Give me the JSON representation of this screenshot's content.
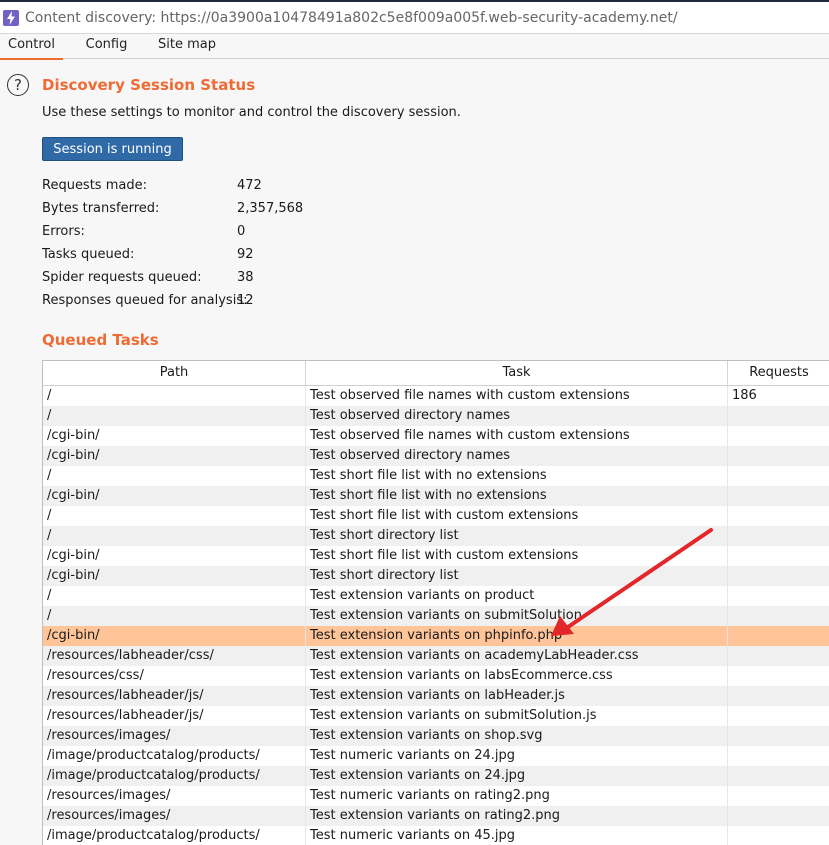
{
  "window": {
    "title": "Content discovery: https://0a3900a10478491a802c5e8f009a005f.web-security-academy.net/"
  },
  "tabs": [
    {
      "label": "Control"
    },
    {
      "label": "Config"
    },
    {
      "label": "Site map"
    }
  ],
  "status": {
    "heading": "Discovery Session Status",
    "description": "Use these settings to monitor and control the discovery session.",
    "button_label": "Session is running",
    "stats": [
      {
        "label": "Requests made:",
        "value": "472"
      },
      {
        "label": "Bytes transferred:",
        "value": "2,357,568"
      },
      {
        "label": "Errors:",
        "value": "0"
      },
      {
        "label": "Tasks queued:",
        "value": "92"
      },
      {
        "label": "Spider requests queued:",
        "value": "38"
      },
      {
        "label": "Responses queued for analysis:",
        "value": "12"
      }
    ]
  },
  "queued": {
    "heading": "Queued Tasks",
    "columns": [
      "Path",
      "Task",
      "Requests"
    ],
    "rows": [
      {
        "path": "/",
        "task": "Test observed file names with custom extensions",
        "requests": "186"
      },
      {
        "path": "/",
        "task": "Test observed directory names",
        "requests": ""
      },
      {
        "path": "/cgi-bin/",
        "task": "Test observed file names with custom extensions",
        "requests": ""
      },
      {
        "path": "/cgi-bin/",
        "task": "Test observed directory names",
        "requests": ""
      },
      {
        "path": "/",
        "task": "Test short file list with no extensions",
        "requests": ""
      },
      {
        "path": "/cgi-bin/",
        "task": "Test short file list with no extensions",
        "requests": ""
      },
      {
        "path": "/",
        "task": "Test short file list with custom extensions",
        "requests": ""
      },
      {
        "path": "/",
        "task": "Test short directory list",
        "requests": ""
      },
      {
        "path": "/cgi-bin/",
        "task": "Test short file list with custom extensions",
        "requests": ""
      },
      {
        "path": "/cgi-bin/",
        "task": "Test short directory list",
        "requests": ""
      },
      {
        "path": "/",
        "task": "Test extension variants on product",
        "requests": ""
      },
      {
        "path": "/",
        "task": "Test extension variants on submitSolution",
        "requests": ""
      },
      {
        "path": "/cgi-bin/",
        "task": "Test extension variants on phpinfo.php",
        "requests": ""
      },
      {
        "path": "/resources/labheader/css/",
        "task": "Test extension variants on academyLabHeader.css",
        "requests": ""
      },
      {
        "path": "/resources/css/",
        "task": "Test extension variants on labsEcommerce.css",
        "requests": ""
      },
      {
        "path": "/resources/labheader/js/",
        "task": "Test extension variants on labHeader.js",
        "requests": ""
      },
      {
        "path": "/resources/labheader/js/",
        "task": "Test extension variants on submitSolution.js",
        "requests": ""
      },
      {
        "path": "/resources/images/",
        "task": "Test extension variants on shop.svg",
        "requests": ""
      },
      {
        "path": "/image/productcatalog/products/",
        "task": "Test numeric variants on 24.jpg",
        "requests": ""
      },
      {
        "path": "/image/productcatalog/products/",
        "task": "Test extension variants on 24.jpg",
        "requests": ""
      },
      {
        "path": "/resources/images/",
        "task": "Test numeric variants on rating2.png",
        "requests": ""
      },
      {
        "path": "/resources/images/",
        "task": "Test extension variants on rating2.png",
        "requests": ""
      },
      {
        "path": "/image/productcatalog/products/",
        "task": "Test numeric variants on 45.jpg",
        "requests": ""
      }
    ]
  },
  "colors": {
    "accent": "#ee6b35",
    "button": "#2f6aa6",
    "selected_row": "#ffc599",
    "annotation_arrow": "#e3262a"
  },
  "icons": {
    "app": "burp-lightning-icon",
    "help": "help-icon",
    "annotation": "red-arrow"
  }
}
